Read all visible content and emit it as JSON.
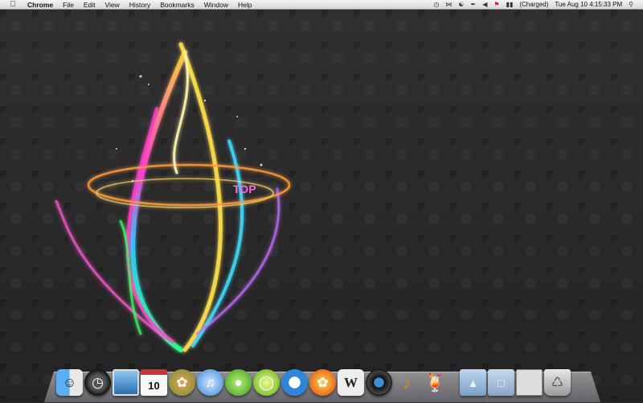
{
  "menubar": {
    "app_name": "Chrome",
    "menus": [
      "File",
      "Edit",
      "View",
      "History",
      "Bookmarks",
      "Window",
      "Help"
    ],
    "battery_status": "(Charged)",
    "datetime": "Tue Aug 10  4:15:33 PM"
  },
  "wallpaper": {
    "text": "TOP"
  },
  "dock": {
    "calendar_day": "10"
  },
  "colors": {
    "menubar_top": "#f4f4f4",
    "desktop_bg": "#2b2b2b"
  }
}
